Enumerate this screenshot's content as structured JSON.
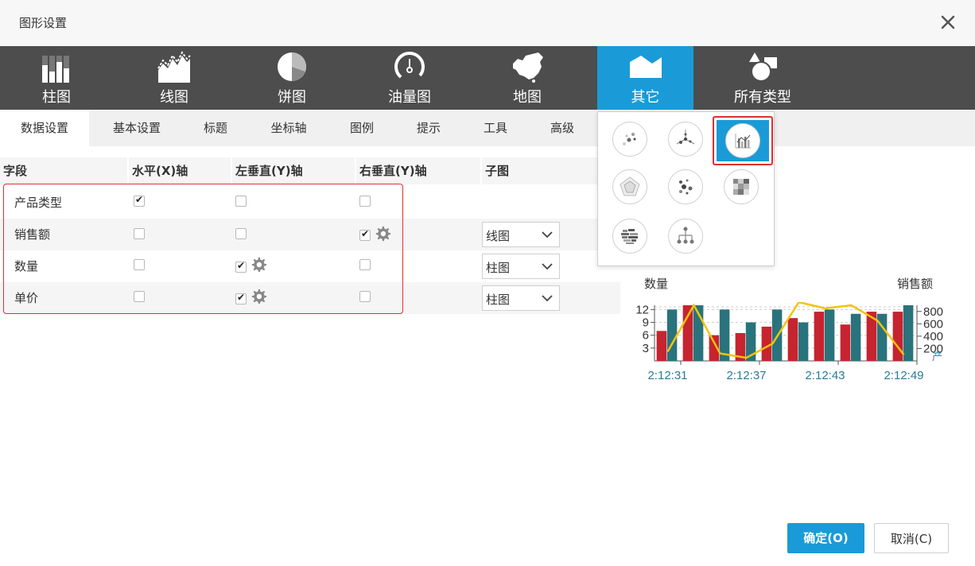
{
  "dialog": {
    "title": "图形设置"
  },
  "chart_types": [
    {
      "label": "柱图",
      "icon": "bar-chart-icon"
    },
    {
      "label": "线图",
      "icon": "line-chart-icon"
    },
    {
      "label": "饼图",
      "icon": "pie-chart-icon"
    },
    {
      "label": "油量图",
      "icon": "gauge-chart-icon"
    },
    {
      "label": "地图",
      "icon": "map-chart-icon"
    },
    {
      "label": "其它",
      "icon": "other-chart-icon",
      "active": true
    },
    {
      "label": "所有类型",
      "icon": "all-types-icon"
    }
  ],
  "tabs": [
    {
      "label": "数据设置",
      "active": true
    },
    {
      "label": "基本设置"
    },
    {
      "label": "标题"
    },
    {
      "label": "坐标轴"
    },
    {
      "label": "图例"
    },
    {
      "label": "提示"
    },
    {
      "label": "工具"
    },
    {
      "label": "高级"
    }
  ],
  "grid": {
    "headers": [
      "字段",
      "水平(X)轴",
      "左垂直(Y)轴",
      "右垂直(Y)轴",
      "子图"
    ],
    "rows": [
      {
        "field": "产品类型",
        "x": true,
        "left_y": false,
        "right_y": false,
        "subchart": ""
      },
      {
        "field": "销售额",
        "x": false,
        "left_y": false,
        "right_y": true,
        "subchart": "线图"
      },
      {
        "field": "数量",
        "x": false,
        "left_y": true,
        "right_y": false,
        "subchart": "柱图"
      },
      {
        "field": "单价",
        "x": false,
        "left_y": true,
        "right_y": false,
        "subchart": "柱图"
      }
    ]
  },
  "popup_icons": [
    "scatter-icon",
    "radial-scatter-icon",
    "combo-chart-icon",
    "radar-icon",
    "bubble-icon",
    "heatmap-icon",
    "word-cloud-icon",
    "tree-icon"
  ],
  "colors": {
    "accent": "#1a9bd7",
    "red_series": "#c6242f",
    "teal_series": "#2a737c",
    "line_series": "#f2c40c",
    "highlight": "#e0302a"
  },
  "chart_data": {
    "type": "bar",
    "left_axis_title": "数量",
    "right_axis_title": "销售额",
    "right_axis_extra_label": "产",
    "x_tick_labels": [
      "2:12:31",
      "2:12:37",
      "2:12:43",
      "2:12:49"
    ],
    "left_ticks": [
      3,
      6,
      9,
      12
    ],
    "right_ticks": [
      200,
      400,
      600,
      800
    ],
    "left_range": [
      0,
      13
    ],
    "right_range": [
      0,
      900
    ],
    "series": [
      {
        "axis": "left",
        "type": "bar",
        "color": "#c6242f",
        "values": [
          7,
          13,
          6,
          6.5,
          8,
          10,
          11.5,
          8.5,
          11.5,
          11.5
        ]
      },
      {
        "axis": "left",
        "type": "bar",
        "color": "#2a737c",
        "values": [
          12,
          13,
          12,
          9,
          12,
          9,
          12,
          11,
          11,
          13
        ]
      },
      {
        "axis": "right",
        "type": "line",
        "color": "#f2c40c",
        "values": [
          150,
          900,
          120,
          50,
          280,
          950,
          850,
          900,
          650,
          100
        ]
      }
    ]
  },
  "footer": {
    "ok_label": "确定(O)",
    "cancel_label": "取消(C)"
  }
}
